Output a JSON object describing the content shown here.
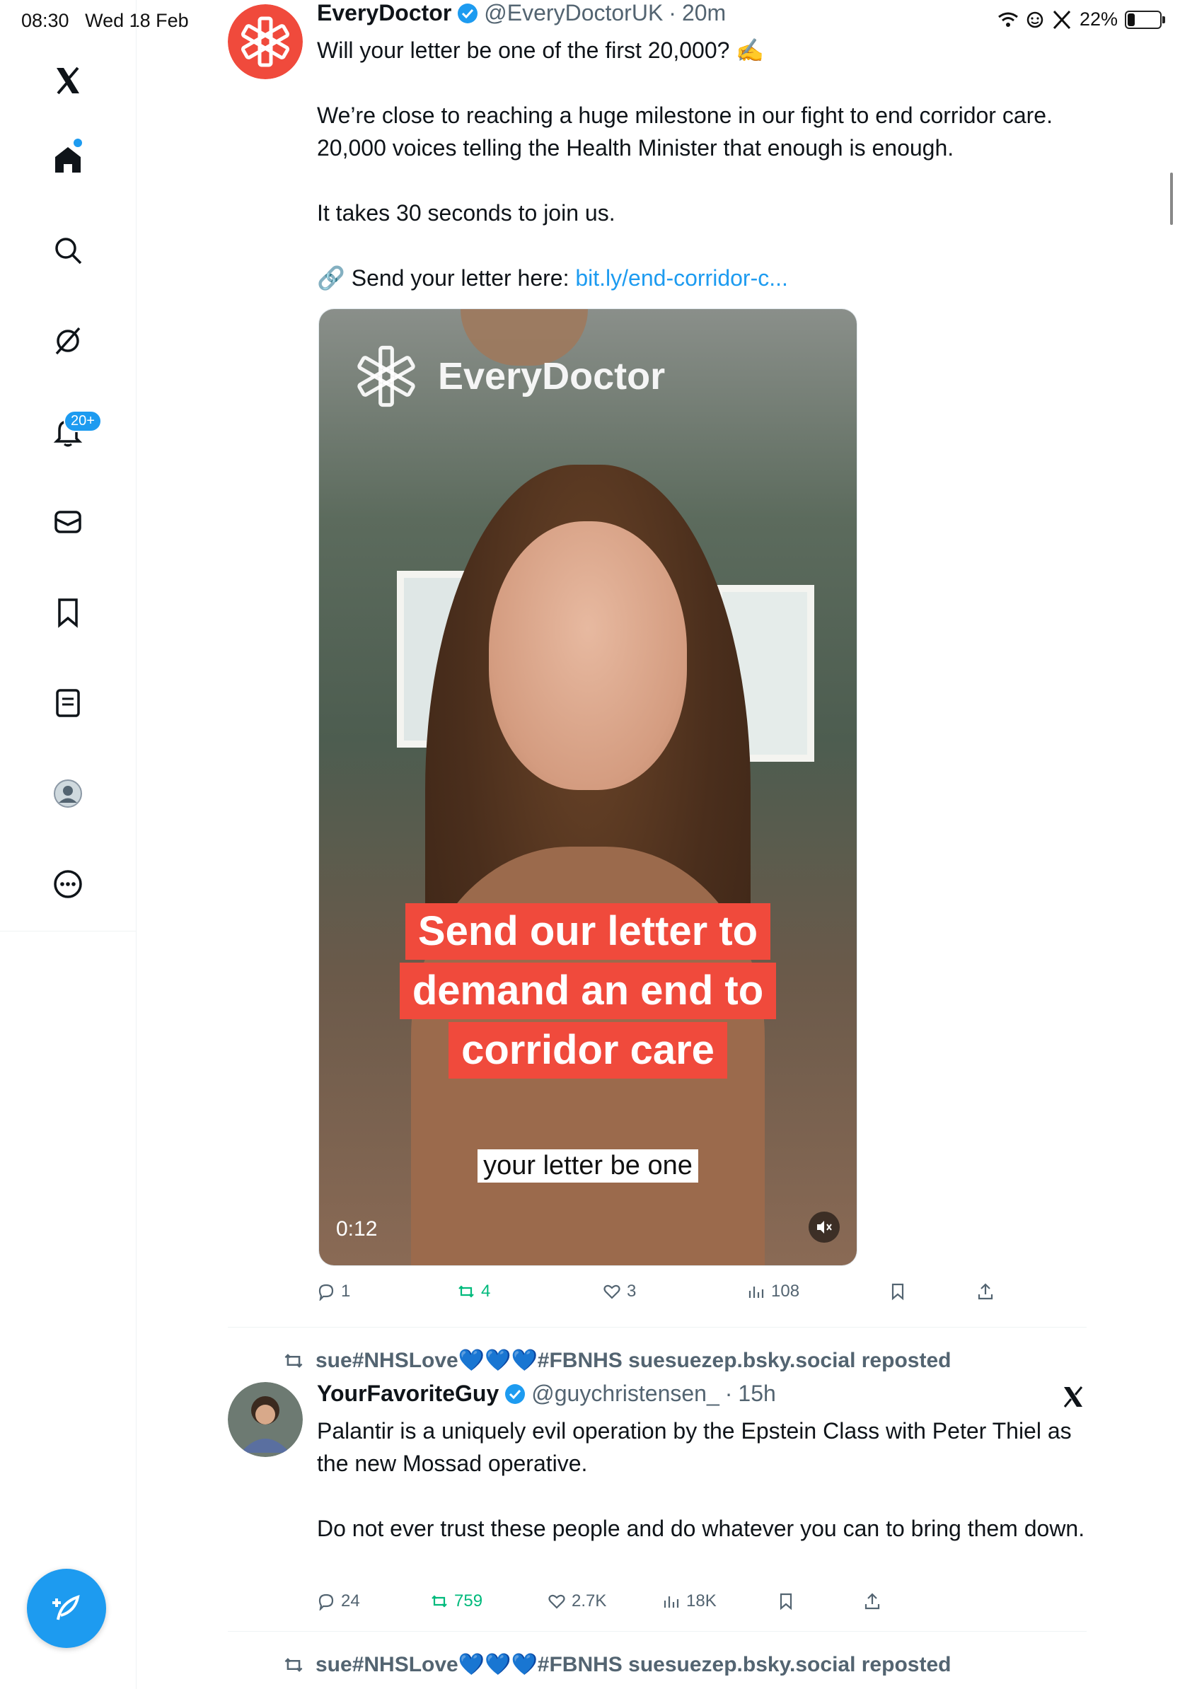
{
  "status_bar": {
    "time": "08:30",
    "date": "Wed 18 Feb",
    "battery": "22%",
    "battery_level": 0.22
  },
  "sidebar": {
    "items": [
      {
        "name": "x-logo-icon"
      },
      {
        "name": "home-icon"
      },
      {
        "name": "search-icon"
      },
      {
        "name": "grok-icon"
      },
      {
        "name": "notifications-icon",
        "badge": "20+"
      },
      {
        "name": "messages-icon"
      },
      {
        "name": "bookmarks-icon"
      },
      {
        "name": "lists-icon"
      },
      {
        "name": "profile-icon"
      },
      {
        "name": "more-icon"
      }
    ],
    "compose_icon": "compose-icon"
  },
  "tweets": [
    {
      "name": "EveryDoctor",
      "handle": "@EveryDoctorUK",
      "time": "20m",
      "text": [
        "Will your letter be one of the first 20,000? ✍️",
        "We’re close to reaching a huge milestone in our fight to end corridor care. 20,000 voices telling the Health Minister that enough is enough.",
        "It takes 30 seconds to join us."
      ],
      "link_prefix": "🔗 Send your letter here: ",
      "link_text": "bit.ly/end-corridor-c...",
      "media": {
        "watermark": "EveryDoctor",
        "caption_lines": [
          "Send our letter to",
          "demand an end to",
          "corridor care"
        ],
        "subtitle": "your letter be one",
        "timecode": "0:12"
      },
      "stats": {
        "replies": "1",
        "reposts": "4",
        "likes": "3",
        "views": "108"
      }
    },
    {
      "reposted_by": "sue#NHSLove💙💙💙#FBNHS suesuezep.bsky.social reposted",
      "name": "YourFavoriteGuy",
      "handle": "@guychristensen_",
      "time": "15h",
      "text": [
        "Palantir is a uniquely evil operation by the Epstein Class with Peter Thiel as the new Mossad operative.",
        "Do not ever trust these people and do whatever you can to bring them down."
      ],
      "stats": {
        "replies": "24",
        "reposts": "759",
        "likes": "2.7K",
        "views": "18K"
      }
    },
    {
      "reposted_by": "sue#NHSLove💙💙💙#FBNHS suesuezep.bsky.social reposted"
    }
  ],
  "colors": {
    "accent": "#1d9bf0",
    "repost_green": "#00ba7c",
    "brand_red": "#f04a3c"
  }
}
